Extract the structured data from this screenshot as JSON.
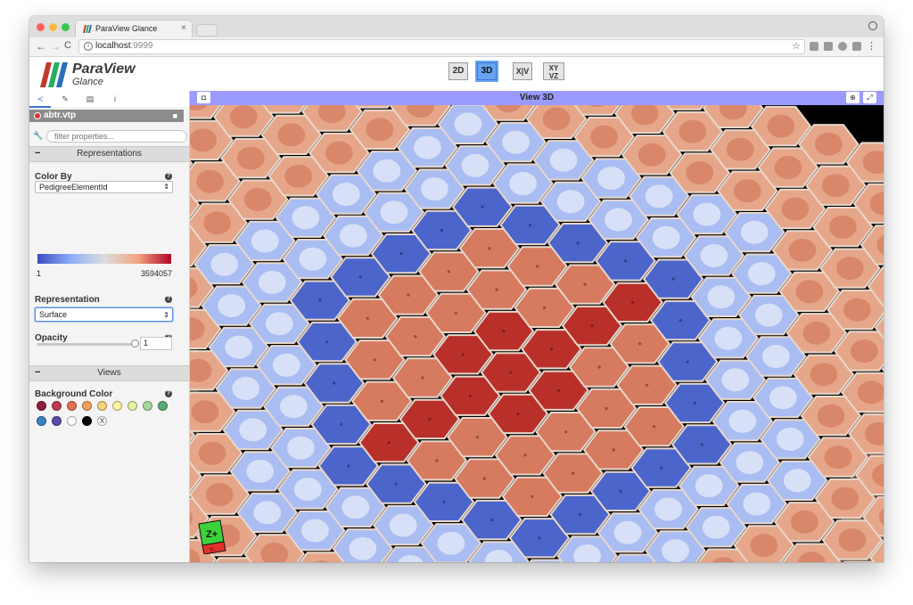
{
  "browser": {
    "tab_title": "ParaView Glance",
    "tab_close": "×",
    "url_host": "localhost",
    "url_port": ":9999",
    "nav_back": "←",
    "nav_forward": "→",
    "nav_reload": "C",
    "bookmark": "☆",
    "menu": "⋮",
    "info": "i"
  },
  "app": {
    "brand_name": "ParaView",
    "brand_sub": "Glance",
    "view_buttons": [
      "2D",
      "3D",
      "X|V",
      "XY|VZ"
    ],
    "active_view_button": "3D"
  },
  "sidebar": {
    "tabs": [
      {
        "icon": "share-icon",
        "glyph": "≺"
      },
      {
        "icon": "pencil-icon",
        "glyph": "✎"
      },
      {
        "icon": "document-icon",
        "glyph": "▤"
      },
      {
        "icon": "info-icon",
        "glyph": "i"
      }
    ],
    "file_name": "abtr.vtp",
    "trash_glyph": "■",
    "filter_placeholder": "filter properties...",
    "sections": {
      "representations": "Representations",
      "views": "Views"
    },
    "collapse_glyph": "−",
    "help_glyph": "?",
    "color_by_label": "Color By",
    "color_by_value": "PedigreeElementId",
    "colorbar_min": "1",
    "colorbar_max": "3594057",
    "representation_label": "Representation",
    "representation_value": "Surface",
    "opacity_label": "Opacity",
    "opacity_value": "1",
    "bg_color_label": "Background Color",
    "bg_colors": [
      "#8e1c3b",
      "#c1394f",
      "#e4704f",
      "#f4a05c",
      "#f9d27a",
      "#fbf4a0",
      "#e3f1a0",
      "#a8d8a0",
      "#5aaa7a",
      "#3b82c4",
      "#5b4aa8",
      "#ffffff",
      "#000000"
    ],
    "bg_none_glyph": "X",
    "select_caret": "⇕"
  },
  "view": {
    "title": "View 3D",
    "screenshot_glyph": "◘",
    "globe_glyph": "⊕",
    "fit_glyph": "⤢",
    "orientation_label": "Z+",
    "orientation_sub": "Y-"
  },
  "colors": {
    "accent": "#6aa3f1",
    "view_header": "#9a9aff",
    "blue_dark": "#4b65cb",
    "blue_light": "#a9bdf3",
    "red_dark": "#b9302a",
    "red_mid": "#d67a60",
    "salmon": "#e6a68a"
  }
}
